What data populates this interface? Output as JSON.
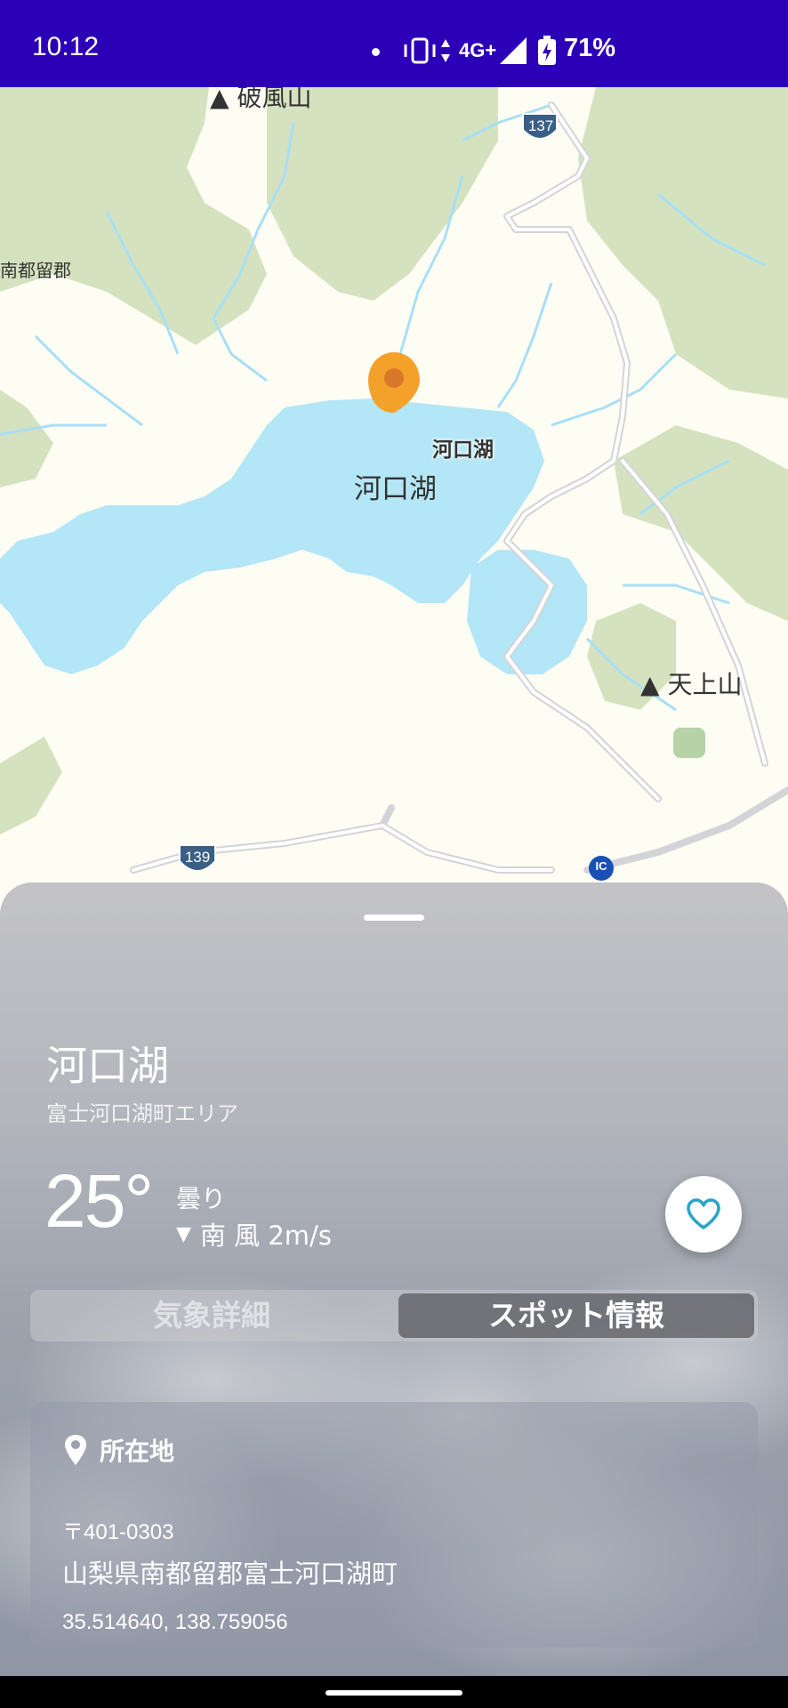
{
  "status_bar": {
    "time": "10:12",
    "network": "4G+",
    "battery": "71%"
  },
  "map": {
    "labels": {
      "mountain_top": "破風山",
      "district": "南都留郡",
      "lake_label": "河口湖",
      "lake_marker_label": "河口湖",
      "mountain_right": "天上山",
      "route_137": "137",
      "route_139": "139",
      "ic": "IC"
    },
    "colors": {
      "land": "#fdfdf3",
      "forest": "#d5e2c0",
      "water": "#b3e6f6",
      "road": "#d3d4d8",
      "pin": "#f4a12b"
    }
  },
  "sheet": {
    "spot_name": "河口湖",
    "spot_area": "富士河口湖町エリア",
    "temperature": "25°",
    "condition": "曇り",
    "wind": "南 風 2m/s",
    "tabs": [
      "気象詳細",
      "スポット情報"
    ],
    "active_tab": "スポット情報",
    "location_card": {
      "heading": "所在地",
      "postal_code": "〒401-0303",
      "address": "山梨県南都留郡富士河口湖町",
      "coordinates": "35.514640, 138.759056"
    }
  }
}
